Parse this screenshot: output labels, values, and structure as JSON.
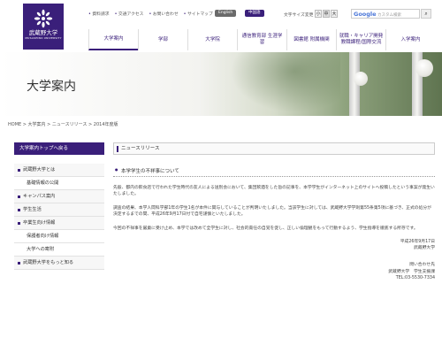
{
  "logo": {
    "name_jp": "武蔵野大学",
    "name_en": "MUSASHINO UNIVERSITY"
  },
  "utility": {
    "links": [
      "資料請求",
      "交通アクセス",
      "お問い合わせ",
      "サイトマップ"
    ],
    "pill_a": "English",
    "pill_b": "中国語",
    "font_size_label": "文字サイズ変更",
    "font_sizes": [
      "小",
      "中",
      "大"
    ],
    "search_placeholder": "カスタム検索",
    "search_brand": "Google"
  },
  "nav": [
    "大学案内",
    "学部",
    "大学院",
    "通信教育部 生涯学習",
    "図書館 附属機関",
    "就職・キャリア開発 教職課程/国際交流",
    "入学案内"
  ],
  "banner": {
    "title": "大学案内"
  },
  "breadcrumb": "HOME > 大学案内 > ニュースリリース > 2014年度版",
  "sidebar": {
    "header": "大学案内トップへ戻る",
    "items": [
      {
        "label": "武蔵野大学とは",
        "sub": false
      },
      {
        "label": "基礎情報の公開",
        "sub": true
      },
      {
        "label": "キャンパス案内",
        "sub": false
      },
      {
        "label": "学生生活",
        "sub": false
      },
      {
        "label": "卒業生向け情報",
        "sub": false
      },
      {
        "label": "保護者向け情報",
        "sub": true
      },
      {
        "label": "大学への寄附",
        "sub": true
      },
      {
        "label": "武蔵野大学をもっと知る",
        "sub": false
      }
    ]
  },
  "main": {
    "section_title": "ニュースリリース",
    "news_title": "本学学生の不祥事について",
    "paragraphs": [
      "先般、都内の飲食店で行われた学生時代の友人による送別会において、集団飲酒をした旨の記事を、本学学生がインターネット上のサイトへ投稿したという事案が発生いたしました。",
      "調査の結果、本学人間科学部1年の学生1名が本件に関与していることが判明いたしました。当該学生に対しては、武蔵野大学学則第55条第5項に基づき、正式の処分が決定するまでの間、平成26年9月17日付で自宅謹慎といたしました。",
      "今回の不祥事を厳粛に受け止め、本学では改めて全学生に対し、社会的責任の自覚を促し、正しい倫理観をもって行動するよう、学生指導を徹底する所存です。"
    ],
    "date": "平成26年9月17日",
    "org": "武蔵野大学",
    "contact_label": "問い合わせ先",
    "contact_dept": "武蔵野大学　学生支援課",
    "contact_tel": "TEL:03-5530-7334"
  }
}
